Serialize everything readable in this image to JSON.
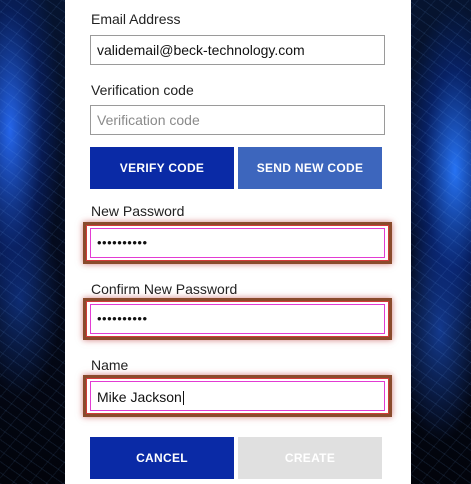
{
  "email": {
    "label": "Email Address",
    "value": "validemail@beck-technology.com"
  },
  "verification": {
    "label": "Verification code",
    "placeholder": "Verification code"
  },
  "buttons": {
    "verify": "VERIFY CODE",
    "send_new": "SEND NEW CODE",
    "cancel": "CANCEL",
    "create": "CREATE"
  },
  "new_password": {
    "label": "New Password",
    "value": "••••••••••"
  },
  "confirm_password": {
    "label": "Confirm New Password",
    "value": "••••••••••"
  },
  "name": {
    "label": "Name",
    "value": "Mike Jackson"
  },
  "colors": {
    "primary": "#0a2aa6",
    "secondary": "#3d66bd",
    "disabled": "#e0e0e0",
    "highlight": "#8a4b2c"
  }
}
